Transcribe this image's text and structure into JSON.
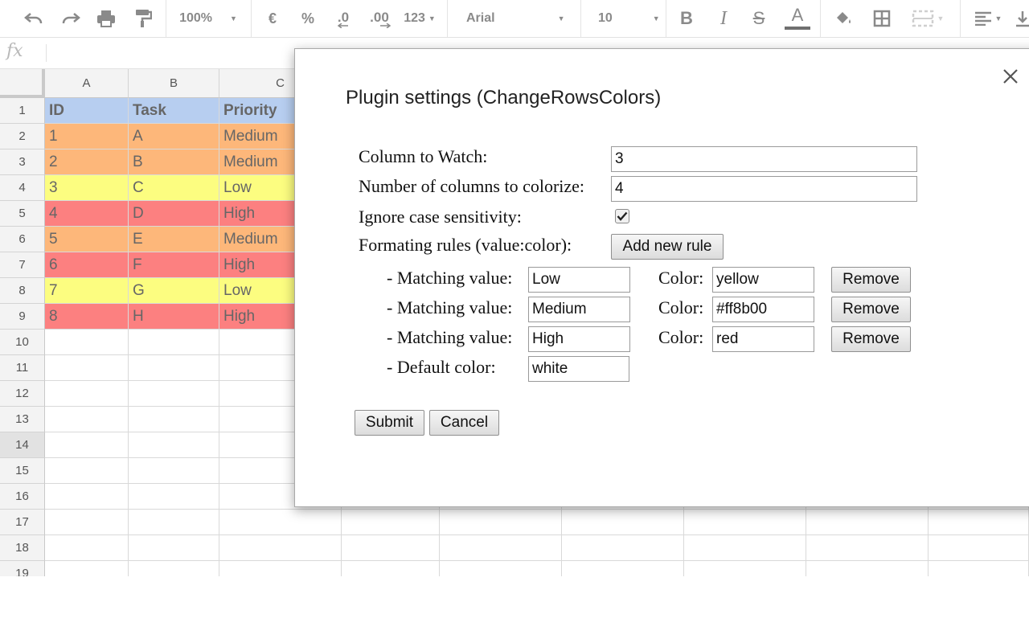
{
  "toolbar": {
    "zoom": "100%",
    "currency": "€",
    "percent": "%",
    "dec_decrease": ".0",
    "dec_increase": ".00",
    "more_formats": "123",
    "font": "Arial",
    "font_size": "10",
    "bold": "B",
    "italic": "I",
    "strike": "S",
    "text_color": "A",
    "colors": {
      "text_color_bar": "#6f6f6f"
    }
  },
  "formula_bar": {
    "fx": "fx",
    "value": ""
  },
  "sheet": {
    "columns": [
      "A",
      "B",
      "C"
    ],
    "row_numbers": [
      "1",
      "2",
      "3",
      "4",
      "5",
      "6",
      "7",
      "8",
      "9",
      "10",
      "11",
      "12",
      "13",
      "14",
      "15",
      "16",
      "17",
      "18",
      "19"
    ],
    "rows": [
      {
        "cells": [
          "ID",
          "Task",
          "Priority"
        ],
        "color": "#b7cef0"
      },
      {
        "cells": [
          "1",
          "A",
          "Medium"
        ],
        "color": "#fdb77a"
      },
      {
        "cells": [
          "2",
          "B",
          "Medium"
        ],
        "color": "#fdb77a"
      },
      {
        "cells": [
          "3",
          "C",
          "Low"
        ],
        "color": "#fcfd80"
      },
      {
        "cells": [
          "4",
          "D",
          "High"
        ],
        "color": "#fc8080"
      },
      {
        "cells": [
          "5",
          "E",
          "Medium"
        ],
        "color": "#fdb77a"
      },
      {
        "cells": [
          "6",
          "F",
          "High"
        ],
        "color": "#fc8080"
      },
      {
        "cells": [
          "7",
          "G",
          "Low"
        ],
        "color": "#fcfd80"
      },
      {
        "cells": [
          "8",
          "H",
          "High"
        ],
        "color": "#fc8080"
      }
    ]
  },
  "dialog": {
    "title": "Plugin settings (ChangeRowsColors)",
    "column_to_watch_label": "Column to Watch:",
    "column_to_watch_value": "3",
    "num_columns_label": "Number of columns to colorize:",
    "num_columns_value": "4",
    "ignore_case_label": "Ignore case sensitivity:",
    "ignore_case_checked": true,
    "formatting_rules_label": "Formating rules (value:color):",
    "add_rule_label": "Add new rule",
    "rules": [
      {
        "match_label": "- Matching value:",
        "value": "Low",
        "color_label": "Color:",
        "color": "yellow",
        "remove_label": "Remove"
      },
      {
        "match_label": "- Matching value:",
        "value": "Medium",
        "color_label": "Color:",
        "color": "#ff8b00",
        "remove_label": "Remove"
      },
      {
        "match_label": "- Matching value:",
        "value": "High",
        "color_label": "Color:",
        "color": "red",
        "remove_label": "Remove"
      }
    ],
    "default_color_label": "- Default color:",
    "default_color_value": "white",
    "submit_label": "Submit",
    "cancel_label": "Cancel"
  }
}
